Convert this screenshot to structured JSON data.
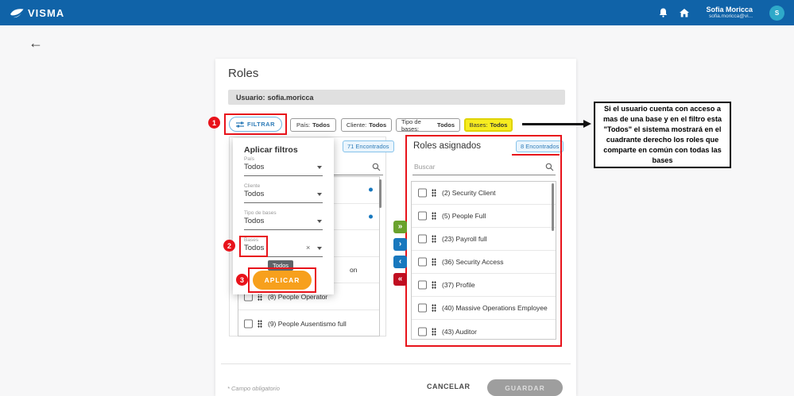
{
  "topbar": {
    "brand": "VISMA",
    "user_name": "Sofia Moricca",
    "user_email": "sofia.moricca@vi...",
    "avatar_initial": "S"
  },
  "nav": {
    "back_arrow": "←"
  },
  "page": {
    "title": "Roles",
    "user_label": "Usuario:",
    "user_value": "sofia.moricca"
  },
  "filter_bar": {
    "filtrar": "FILTRAR",
    "chips": [
      {
        "label": "País:",
        "value": "Todos"
      },
      {
        "label": "Cliente:",
        "value": "Todos"
      },
      {
        "label": "Tipo de bases:",
        "value": "Todos"
      },
      {
        "label": "Bases:",
        "value": "Todos"
      }
    ]
  },
  "filter_panel": {
    "title": "Aplicar filtros",
    "fields": [
      {
        "label": "País",
        "value": "Todos"
      },
      {
        "label": "Cliente",
        "value": "Todos"
      },
      {
        "label": "Tipo de bases",
        "value": "Todos"
      },
      {
        "label": "Bases",
        "value": "Todos"
      }
    ],
    "clear_glyph": "×",
    "tooltip": "Todos",
    "apply": "APLICAR"
  },
  "steps": {
    "one": "1",
    "two": "2",
    "three": "3"
  },
  "available_panel": {
    "badge": "71 Encontrados",
    "partial_text": "on",
    "rows": [
      "(8) People Operator",
      "(9) People Ausentismo full"
    ]
  },
  "assigned_panel": {
    "title": "Roles asignados",
    "badge": "8 Encontrados",
    "search_placeholder": "Buscar",
    "rows": [
      "(2) Security Client",
      "(5) People Full",
      "(23) Payroll full",
      "(36) Security Access",
      "(37) Profile",
      "(40) Massive Operations Employee",
      "(43) Auditor"
    ]
  },
  "transfer_buttons": {
    "all_right": "»",
    "right": "›",
    "left": "‹",
    "all_left": "«"
  },
  "note": {
    "text": "Si el usuario cuenta con acceso a mas de una base y en el filtro esta \"Todos\" el sistema mostrará en el cuadrante derecho los roles que comparte en común con todas las bases"
  },
  "footer": {
    "required": "* Campo obligatorio",
    "cancel": "CANCELAR",
    "save": "GUARDAR"
  },
  "colors": {
    "topbar_blue": "#1063A8",
    "accent_orange": "#F7A01D",
    "annotation_red": "#E8131B",
    "highlight_yellow": "#F7EC1F",
    "badge_blue": "#2E7CB8",
    "transfer_green": "#6AA22D",
    "transfer_blue": "#1878BE",
    "transfer_red": "#C00E21",
    "avatar_cyan": "#2EA9C9"
  }
}
